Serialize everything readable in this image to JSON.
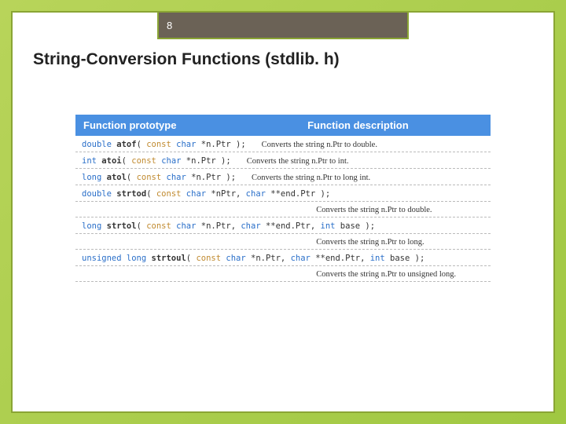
{
  "page_number": "8",
  "title": "String-Conversion Functions (stdlib. h)",
  "header": {
    "prototype": "Function prototype",
    "description": "Function description"
  },
  "rows": [
    {
      "tokens": [
        {
          "t": "double",
          "c": "kw-type"
        },
        {
          "t": " "
        },
        {
          "t": "atof",
          "c": "fn"
        },
        {
          "t": "( "
        },
        {
          "t": "const",
          "c": "kw-const"
        },
        {
          "t": " "
        },
        {
          "t": "char",
          "c": "kw-type"
        },
        {
          "t": " *n.Ptr );"
        }
      ],
      "desc_inline": "Converts the string n.Ptr to double."
    },
    {
      "tokens": [
        {
          "t": "int",
          "c": "kw-type"
        },
        {
          "t": " "
        },
        {
          "t": "atoi",
          "c": "fn"
        },
        {
          "t": "( "
        },
        {
          "t": "const",
          "c": "kw-const"
        },
        {
          "t": " "
        },
        {
          "t": "char",
          "c": "kw-type"
        },
        {
          "t": " *n.Ptr );"
        }
      ],
      "desc_inline": "Converts the string n.Ptr to int."
    },
    {
      "tokens": [
        {
          "t": "long",
          "c": "kw-type"
        },
        {
          "t": " "
        },
        {
          "t": "atol",
          "c": "fn"
        },
        {
          "t": "( "
        },
        {
          "t": "const",
          "c": "kw-const"
        },
        {
          "t": " "
        },
        {
          "t": "char",
          "c": "kw-type"
        },
        {
          "t": " *n.Ptr );"
        }
      ],
      "desc_inline": "Converts the string n.Ptr to long int."
    },
    {
      "tokens": [
        {
          "t": "double",
          "c": "kw-type"
        },
        {
          "t": " "
        },
        {
          "t": "strtod",
          "c": "fn"
        },
        {
          "t": "( "
        },
        {
          "t": "const",
          "c": "kw-const"
        },
        {
          "t": " "
        },
        {
          "t": "char",
          "c": "kw-type"
        },
        {
          "t": " *nPtr, "
        },
        {
          "t": "char",
          "c": "kw-type"
        },
        {
          "t": " **end.Ptr );"
        }
      ]
    },
    {
      "desc_row": "Converts the string n.Ptr to double."
    },
    {
      "tokens": [
        {
          "t": "long",
          "c": "kw-type"
        },
        {
          "t": " "
        },
        {
          "t": "strtol",
          "c": "fn"
        },
        {
          "t": "( "
        },
        {
          "t": "const",
          "c": "kw-const"
        },
        {
          "t": " "
        },
        {
          "t": "char",
          "c": "kw-type"
        },
        {
          "t": " *n.Ptr, "
        },
        {
          "t": "char",
          "c": "kw-type"
        },
        {
          "t": " **end.Ptr, "
        },
        {
          "t": "int",
          "c": "kw-type"
        },
        {
          "t": " base );"
        }
      ]
    },
    {
      "desc_row": "Converts the string n.Ptr to long."
    },
    {
      "tokens": [
        {
          "t": "unsigned long",
          "c": "kw-type"
        },
        {
          "t": " "
        },
        {
          "t": "strtoul",
          "c": "fn"
        },
        {
          "t": "( "
        },
        {
          "t": "const",
          "c": "kw-const"
        },
        {
          "t": " "
        },
        {
          "t": "char",
          "c": "kw-type"
        },
        {
          "t": " *n.Ptr, "
        },
        {
          "t": "char",
          "c": "kw-type"
        },
        {
          "t": " **end.Ptr, "
        },
        {
          "t": "int",
          "c": "kw-type"
        },
        {
          "t": " base );"
        }
      ]
    },
    {
      "desc_row": "Converts the string n.Ptr to unsigned long."
    }
  ]
}
